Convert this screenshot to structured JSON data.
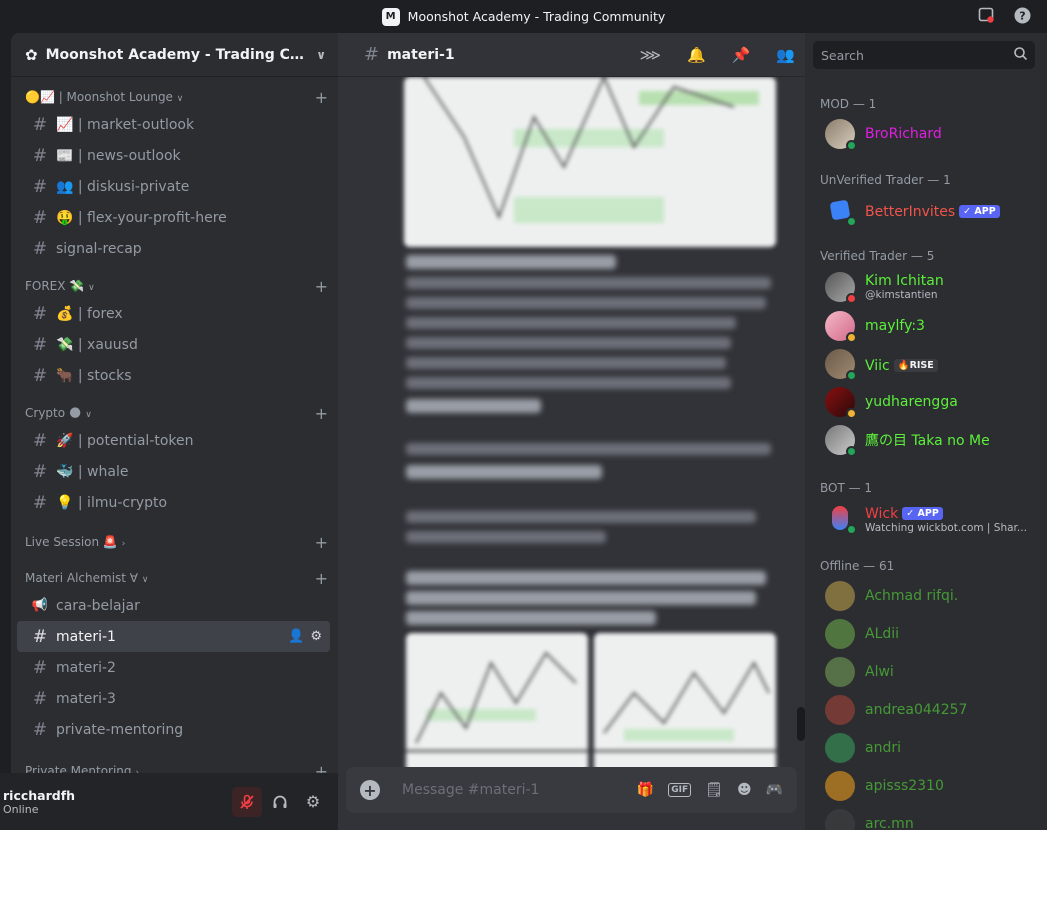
{
  "window": {
    "title": "Moonshot Academy - Trading Community"
  },
  "server": {
    "name": "Moonshot Academy - Trading Commun..."
  },
  "sidebar": {
    "groups": [
      {
        "label": "🟡📈 | Moonshot Lounge",
        "channels": [
          "📈 | market-outlook",
          "📰 | news-outlook",
          "👥 | diskusi-private",
          "🤑 | flex-your-profit-here",
          "signal-recap"
        ]
      },
      {
        "label": "FOREX 💸",
        "channels": [
          "💰 | forex",
          "💸 | xauusd",
          "🐂 | stocks"
        ]
      },
      {
        "label": "Crypto 🌑",
        "channels": [
          "🚀 | potential-token",
          "🐳 | whale",
          "💡 | ilmu-crypto"
        ]
      },
      {
        "label": "Live Session 🚨",
        "channels": []
      },
      {
        "label": "Materi Alchemist ∀",
        "channels": [
          "cara-belajar",
          "materi-1",
          "materi-2",
          "materi-3",
          "private-mentoring"
        ]
      },
      {
        "label": "Private Mentoring",
        "channels": []
      }
    ],
    "active_channel": "materi-1"
  },
  "user": {
    "name": "ricchardfh",
    "status": "Online"
  },
  "chat": {
    "channel": "materi-1",
    "placeholder": "Message #materi-1"
  },
  "members": {
    "search_placeholder": "Search",
    "groups": [
      {
        "title": "MOD — 1"
      },
      {
        "title": "UnVerified Trader — 1"
      },
      {
        "title": "Verified Trader — 5"
      },
      {
        "title": "BOT — 1"
      },
      {
        "title": "Offline — 61"
      }
    ],
    "mod": [
      {
        "name": "BroRichard",
        "color": "#e01ee0"
      }
    ],
    "unverified": [
      {
        "name": "BetterInvites",
        "color": "#f2544b",
        "tag": "✓ APP"
      }
    ],
    "verified": [
      {
        "name": "Kim Ichitan",
        "sub": "@kimstantien",
        "color": "#5cf03a"
      },
      {
        "name": "maylfy:3",
        "color": "#5cf03a"
      },
      {
        "name": "Viic",
        "tag": "🔥RISE",
        "color": "#5cf03a"
      },
      {
        "name": "yudharengga",
        "color": "#5cf03a"
      },
      {
        "name": "鷹の目 Taka no Me",
        "color": "#5cf03a"
      }
    ],
    "bot": [
      {
        "name": "Wick",
        "tag": "✓ APP",
        "sub": "Watching wickbot.com | Shar...",
        "color": "#f23f43"
      }
    ],
    "offline": [
      "Achmad rifqi.",
      "ALdii",
      "Alwi",
      "andrea044257",
      "andri",
      "apisss2310",
      "arc.mn"
    ]
  },
  "colors": {
    "accent": "#5865f2",
    "online": "#23a55a",
    "dnd": "#f23f43",
    "idle": "#f0b232"
  }
}
